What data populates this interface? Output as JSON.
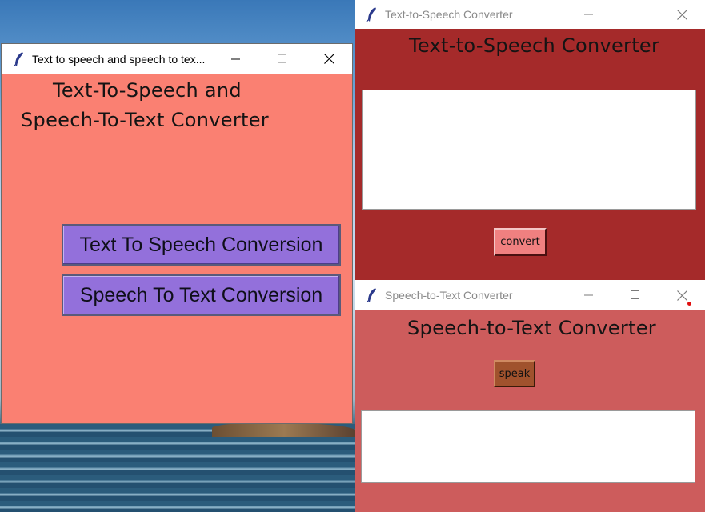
{
  "main_window": {
    "title": "Text to speech and speech to tex...",
    "heading_line1": "Text-To-Speech and",
    "heading_line2": "Speech-To-Text Converter",
    "buttons": {
      "tts_label": "Text To Speech Conversion",
      "stt_label": "Speech To Text Conversion"
    }
  },
  "tts_window": {
    "title": "Text-to-Speech Converter",
    "heading": "Text-to-Speech Converter",
    "text_input_value": "",
    "convert_label": "convert"
  },
  "stt_window": {
    "title": "Speech-to-Text Converter",
    "heading": "Speech-to-Text Converter",
    "speak_label": "speak",
    "output_value": ""
  },
  "colors": {
    "main_bg": "#fa8072",
    "button_purple": "#9370db",
    "tts_bg": "#a52a2a",
    "stt_bg": "#cd5c5c",
    "convert_btn": "#f08080",
    "speak_btn": "#a0522d"
  },
  "icons": {
    "app_icon": "feather-icon",
    "minimize": "minimize-icon",
    "maximize": "maximize-icon",
    "close": "close-icon"
  }
}
